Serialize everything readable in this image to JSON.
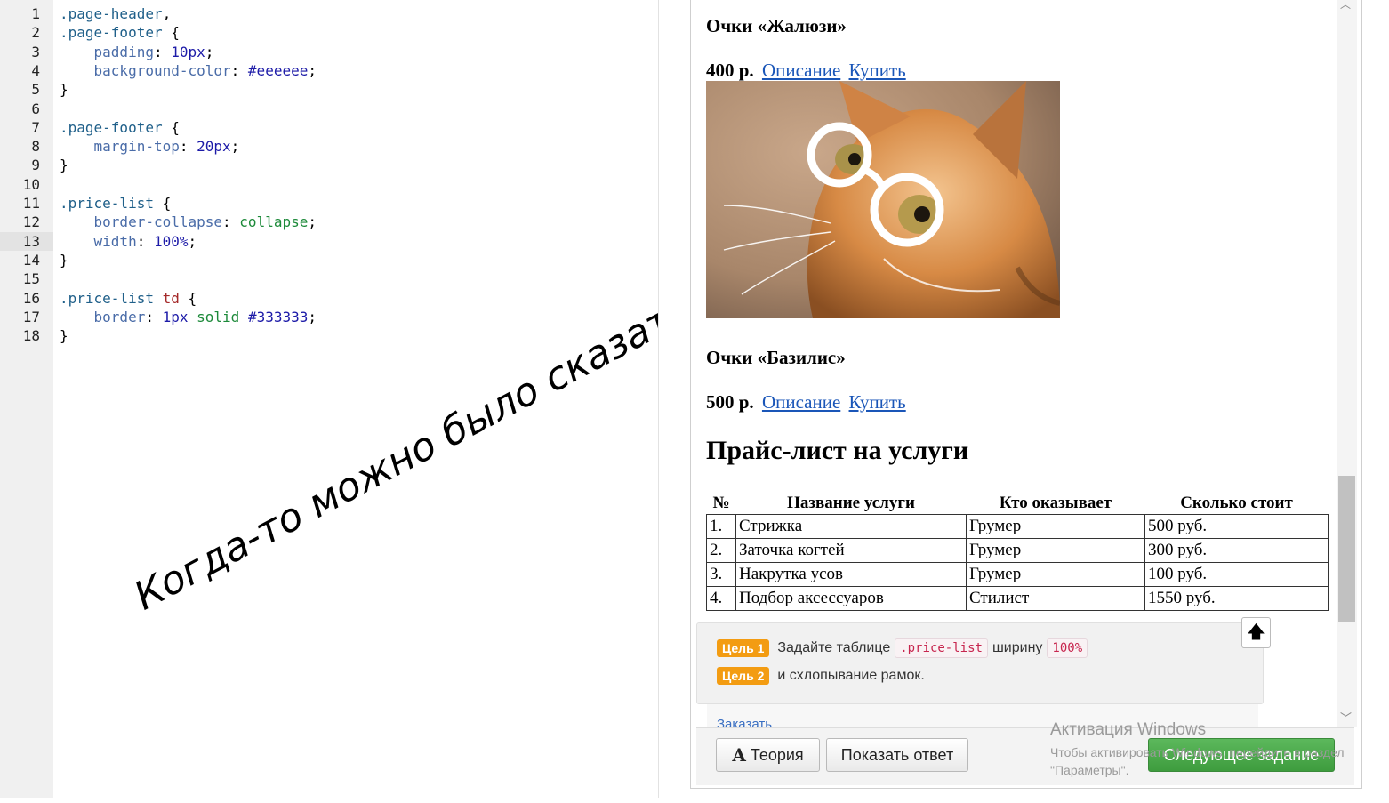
{
  "editor": {
    "lines": [
      {
        "n": "1",
        "tokens": [
          {
            "t": ".page-header",
            "c": "sel"
          },
          {
            "t": ",",
            "c": "p"
          }
        ]
      },
      {
        "n": "2",
        "tokens": [
          {
            "t": ".page-footer",
            "c": "sel"
          },
          {
            "t": " {",
            "c": "p"
          }
        ]
      },
      {
        "n": "3",
        "tokens": [
          {
            "t": "    padding",
            "c": "prop"
          },
          {
            "t": ": ",
            "c": "p"
          },
          {
            "t": "10px",
            "c": "num"
          },
          {
            "t": ";",
            "c": "p"
          }
        ]
      },
      {
        "n": "4",
        "tokens": [
          {
            "t": "    background-color",
            "c": "prop"
          },
          {
            "t": ": ",
            "c": "p"
          },
          {
            "t": "#eeeeee",
            "c": "num"
          },
          {
            "t": ";",
            "c": "p"
          }
        ]
      },
      {
        "n": "5",
        "tokens": [
          {
            "t": "}",
            "c": "p"
          }
        ]
      },
      {
        "n": "6",
        "tokens": []
      },
      {
        "n": "7",
        "tokens": [
          {
            "t": ".page-footer",
            "c": "sel"
          },
          {
            "t": " {",
            "c": "p"
          }
        ]
      },
      {
        "n": "8",
        "tokens": [
          {
            "t": "    margin-top",
            "c": "prop"
          },
          {
            "t": ": ",
            "c": "p"
          },
          {
            "t": "20px",
            "c": "num"
          },
          {
            "t": ";",
            "c": "p"
          }
        ]
      },
      {
        "n": "9",
        "tokens": [
          {
            "t": "}",
            "c": "p"
          }
        ]
      },
      {
        "n": "10",
        "tokens": []
      },
      {
        "n": "11",
        "tokens": [
          {
            "t": ".price-list",
            "c": "sel"
          },
          {
            "t": " {",
            "c": "p"
          }
        ]
      },
      {
        "n": "12",
        "tokens": [
          {
            "t": "    border-collapse",
            "c": "prop"
          },
          {
            "t": ": ",
            "c": "p"
          },
          {
            "t": "collapse",
            "c": "kw"
          },
          {
            "t": ";",
            "c": "p"
          }
        ]
      },
      {
        "n": "13",
        "tokens": [
          {
            "t": "    width",
            "c": "prop"
          },
          {
            "t": ": ",
            "c": "p"
          },
          {
            "t": "100%",
            "c": "num"
          },
          {
            "t": ";",
            "c": "p"
          }
        ],
        "active": true
      },
      {
        "n": "14",
        "tokens": [
          {
            "t": "}",
            "c": "p"
          }
        ]
      },
      {
        "n": "15",
        "tokens": []
      },
      {
        "n": "16",
        "tokens": [
          {
            "t": ".price-list",
            "c": "sel"
          },
          {
            "t": " ",
            "c": "p"
          },
          {
            "t": "td",
            "c": "tag"
          },
          {
            "t": " {",
            "c": "p"
          }
        ]
      },
      {
        "n": "17",
        "tokens": [
          {
            "t": "    border",
            "c": "prop"
          },
          {
            "t": ": ",
            "c": "p"
          },
          {
            "t": "1px",
            "c": "num"
          },
          {
            "t": " ",
            "c": "p"
          },
          {
            "t": "solid",
            "c": "kw"
          },
          {
            "t": " ",
            "c": "p"
          },
          {
            "t": "#333333",
            "c": "num"
          },
          {
            "t": ";",
            "c": "p"
          }
        ]
      },
      {
        "n": "18",
        "tokens": [
          {
            "t": "}",
            "c": "p"
          }
        ]
      }
    ],
    "colors": {
      "sel": "#20608a",
      "prop": "#4a6ca8",
      "num": "#1d1ba8",
      "kw": "#1d8a3a",
      "tag": "#a52a2a",
      "p": "#000000"
    }
  },
  "handwriting": "Когда-то можно было сказать \"Кися\"",
  "preview": {
    "products": [
      {
        "title": "Очки «Жалюзи»",
        "price": "400 р.",
        "desc_link": "Описание",
        "buy_link": "Купить"
      },
      {
        "title": "Очки «Базилис»",
        "price": "500 р.",
        "desc_link": "Описание",
        "buy_link": "Купить"
      }
    ],
    "section_title": "Прайс-лист на услуги",
    "table": {
      "headers": [
        "№",
        "Название услуги",
        "Кто оказывает",
        "Сколько стоит"
      ],
      "rows": [
        [
          "1.",
          "Стрижка",
          "Грумер",
          "500 руб."
        ],
        [
          "2.",
          "Заточка когтей",
          "Грумер",
          "300 руб."
        ],
        [
          "3.",
          "Накрутка усов",
          "Грумер",
          "100 руб."
        ],
        [
          "4.",
          "Подбор аксессуаров",
          "Стилист",
          "1550 руб."
        ]
      ]
    },
    "partial_link": "Заказать"
  },
  "tasks": {
    "goal1": {
      "badge": "Цель 1",
      "text_before": "Задайте таблице",
      "code1": ".price-list",
      "text_mid": "ширину",
      "code2": "100%"
    },
    "goal2": {
      "badge": "Цель 2",
      "text": "и схлопывание рамок."
    }
  },
  "buttons": {
    "theory_icon": "A",
    "theory": "Теория",
    "show_answer": "Показать ответ",
    "next_task": "Следующее задание"
  },
  "windows_activation": {
    "title": "Активация Windows",
    "line1": "Чтобы активировать Windows, перейдите в раздел",
    "line2": "\"Параметры\"."
  },
  "theme": {
    "accent_green": "#4cae4c",
    "goal_orange": "#f39c12",
    "link_blue": "#1a56b8"
  }
}
